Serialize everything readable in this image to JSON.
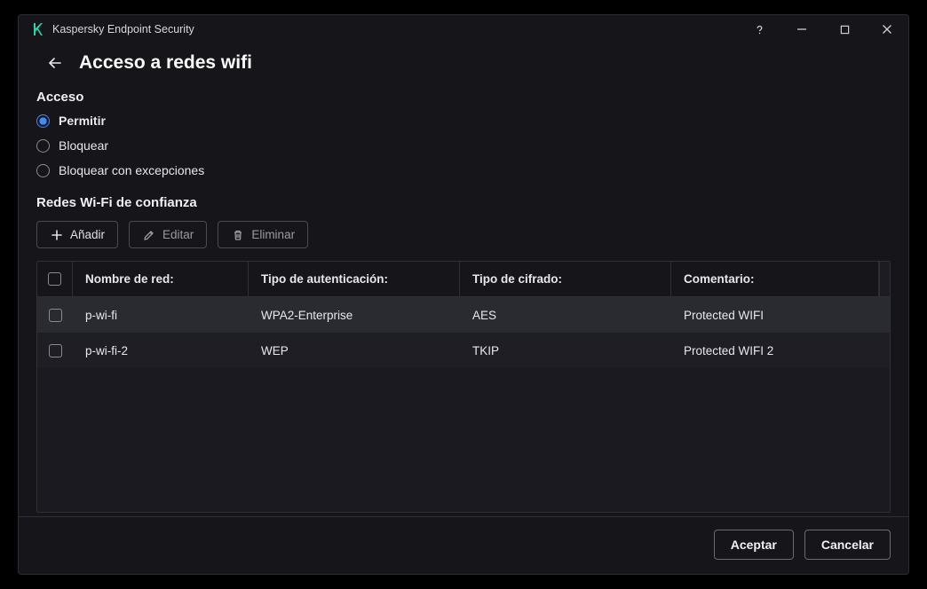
{
  "app": {
    "title": "Kaspersky Endpoint Security"
  },
  "page": {
    "title": "Acceso a redes wifi"
  },
  "access": {
    "section_label": "Acceso",
    "options": [
      {
        "label": "Permitir",
        "checked": true
      },
      {
        "label": "Bloquear",
        "checked": false
      },
      {
        "label": "Bloquear con excepciones",
        "checked": false
      }
    ]
  },
  "trusted": {
    "section_label": "Redes Wi-Fi de confianza",
    "toolbar": {
      "add": "Añadir",
      "edit": "Editar",
      "delete": "Eliminar"
    },
    "columns": {
      "name": "Nombre de red:",
      "auth": "Tipo de autenticación:",
      "enc": "Tipo de cifrado:",
      "comment": "Comentario:"
    },
    "rows": [
      {
        "name": "p-wi-fi",
        "auth": "WPA2-Enterprise",
        "enc": "AES",
        "comment": "Protected WIFI"
      },
      {
        "name": "p-wi-fi-2",
        "auth": "WEP",
        "enc": "TKIP",
        "comment": "Protected WIFI 2"
      }
    ]
  },
  "footer": {
    "ok": "Aceptar",
    "cancel": "Cancelar"
  }
}
